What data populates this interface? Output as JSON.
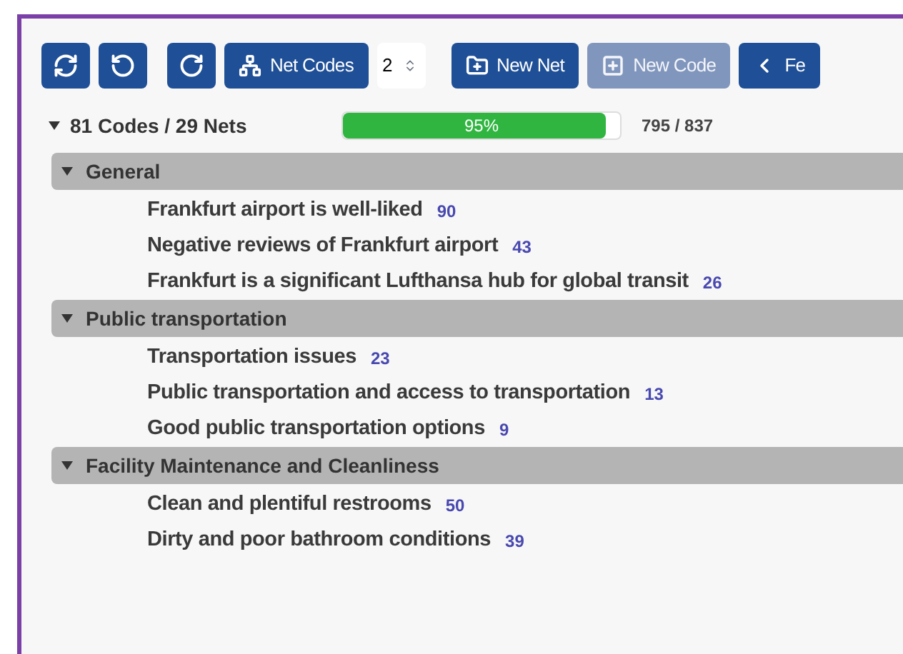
{
  "toolbar": {
    "buttons": [
      {
        "kind": "refresh",
        "disabled": false
      },
      {
        "kind": "undo",
        "disabled": false
      },
      {
        "kind": "redo",
        "disabled": false
      },
      {
        "kind": "tree",
        "label": "Net Codes",
        "disabled": false
      },
      {
        "kind": "spinner",
        "value": "2"
      },
      {
        "kind": "folder",
        "label": "New Net",
        "disabled": false
      },
      {
        "kind": "plus",
        "label": "New Code",
        "disabled": true
      },
      {
        "kind": "back",
        "label": "Fe",
        "disabled": false
      }
    ]
  },
  "summary": {
    "label": "81 Codes / 29 Nets",
    "expanded": true,
    "level": 0.95,
    "percent": "95%",
    "count": "795 / 837"
  },
  "groups": [
    {
      "name": "General",
      "expanded": true,
      "items": [
        {
          "label": "Frankfurt airport is well-liked",
          "count": "90"
        },
        {
          "label": "Negative reviews of Frankfurt airport",
          "count": "43"
        },
        {
          "label": "Frankfurt is a significant Lufthansa hub for global transit",
          "count": "26"
        }
      ]
    },
    {
      "name": "Public transportation",
      "expanded": true,
      "items": [
        {
          "label": "Transportation issues",
          "count": "23"
        },
        {
          "label": "Public transportation and access to transportation",
          "count": "13"
        },
        {
          "label": "Good public transportation options",
          "count": "9"
        }
      ]
    },
    {
      "name": "Facility Maintenance and Cleanliness",
      "expanded": true,
      "items": [
        {
          "label": "Clean and plentiful restrooms",
          "count": "50"
        },
        {
          "label": "Dirty and poor bathroom conditions",
          "count": "39"
        }
      ]
    }
  ]
}
